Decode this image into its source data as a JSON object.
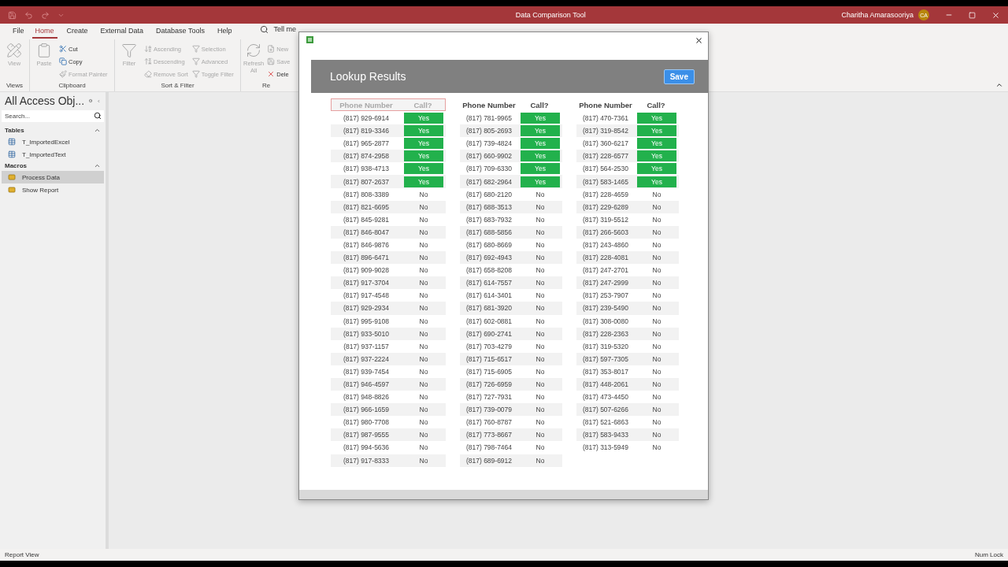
{
  "title_bar": {
    "title": "Data Comparison Tool",
    "user_name": "Charitha Amarasooriya",
    "user_initials": "CA"
  },
  "menu_tabs": [
    {
      "label": "File",
      "selected": false
    },
    {
      "label": "Home",
      "selected": true
    },
    {
      "label": "Create",
      "selected": false
    },
    {
      "label": "External Data",
      "selected": false
    },
    {
      "label": "Database Tools",
      "selected": false
    },
    {
      "label": "Help",
      "selected": false
    }
  ],
  "tell_me": "Tell me",
  "ribbon": [
    {
      "label": "Views",
      "items": [
        {
          "kind": "large",
          "label": "View",
          "disabled": true
        }
      ]
    },
    {
      "label": "Clipboard",
      "items": [
        {
          "kind": "large",
          "label": "Paste",
          "disabled": true
        },
        {
          "kind": "small",
          "label": "Cut",
          "disabled": false
        },
        {
          "kind": "small",
          "label": "Copy",
          "disabled": false
        },
        {
          "kind": "small",
          "label": "Format Painter",
          "disabled": true
        }
      ]
    },
    {
      "label": "Sort & Filter",
      "items": [
        {
          "kind": "large",
          "label": "Filter",
          "disabled": true
        },
        {
          "kind": "small",
          "label": "Ascending",
          "disabled": true
        },
        {
          "kind": "small",
          "label": "Descending",
          "disabled": true
        },
        {
          "kind": "small",
          "label": "Remove Sort",
          "disabled": true
        },
        {
          "kind": "small",
          "label": "Selection",
          "disabled": true
        },
        {
          "kind": "small",
          "label": "Advanced",
          "disabled": true
        },
        {
          "kind": "small",
          "label": "Toggle Filter",
          "disabled": true
        }
      ]
    },
    {
      "label": "Re",
      "items": [
        {
          "kind": "large",
          "label": "Refresh All",
          "disabled": true
        },
        {
          "kind": "small",
          "label": "New",
          "disabled": true
        },
        {
          "kind": "small",
          "label": "Save",
          "disabled": true
        },
        {
          "kind": "small",
          "label": "Dele",
          "disabled": false
        }
      ]
    }
  ],
  "nav_pane": {
    "title": "All Access Obj...",
    "search_placeholder": "Search...",
    "sections": [
      {
        "title": "Tables",
        "expanded": true,
        "items": [
          {
            "label": "T_ImportedExcel",
            "selected": false
          },
          {
            "label": "T_ImportedText",
            "selected": false
          }
        ]
      },
      {
        "title": "Macros",
        "expanded": true,
        "items": [
          {
            "label": "Process Data",
            "selected": true
          },
          {
            "label": "Show Report",
            "selected": false
          }
        ]
      }
    ]
  },
  "dialog": {
    "heading": "Lookup Results",
    "save_button": "Save",
    "tables": [
      {
        "focused": true,
        "columns": [
          "Phone Number",
          "Call?"
        ],
        "rows": [
          {
            "phone": "(817) 929-6914",
            "call": "Yes",
            "highlighted": true
          },
          {
            "phone": "(817) 819-3346",
            "call": "Yes",
            "highlighted": true
          },
          {
            "phone": "(817) 965-2877",
            "call": "Yes",
            "highlighted": true
          },
          {
            "phone": "(817) 874-2958",
            "call": "Yes",
            "highlighted": true
          },
          {
            "phone": "(817) 938-4713",
            "call": "Yes",
            "highlighted": true
          },
          {
            "phone": "(817) 807-2637",
            "call": "Yes",
            "highlighted": true
          },
          {
            "phone": "(817) 808-3389",
            "call": "No",
            "highlighted": false
          },
          {
            "phone": "(817) 821-6695",
            "call": "No",
            "highlighted": false
          },
          {
            "phone": "(817) 845-9281",
            "call": "No",
            "highlighted": false
          },
          {
            "phone": "(817) 846-8047",
            "call": "No",
            "highlighted": false
          },
          {
            "phone": "(817) 846-9876",
            "call": "No",
            "highlighted": false
          },
          {
            "phone": "(817) 896-6471",
            "call": "No",
            "highlighted": false
          },
          {
            "phone": "(817) 909-9028",
            "call": "No",
            "highlighted": false
          },
          {
            "phone": "(817) 917-3704",
            "call": "No",
            "highlighted": false
          },
          {
            "phone": "(817) 917-4548",
            "call": "No",
            "highlighted": false
          },
          {
            "phone": "(817) 929-2934",
            "call": "No",
            "highlighted": false
          },
          {
            "phone": "(817) 995-9108",
            "call": "No",
            "highlighted": false
          },
          {
            "phone": "(817) 933-5010",
            "call": "No",
            "highlighted": false
          },
          {
            "phone": "(817) 937-1157",
            "call": "No",
            "highlighted": false
          },
          {
            "phone": "(817) 937-2224",
            "call": "No",
            "highlighted": false
          },
          {
            "phone": "(817) 939-7454",
            "call": "No",
            "highlighted": false
          },
          {
            "phone": "(817) 946-4597",
            "call": "No",
            "highlighted": false
          },
          {
            "phone": "(817) 948-8826",
            "call": "No",
            "highlighted": false
          },
          {
            "phone": "(817) 966-1659",
            "call": "No",
            "highlighted": false
          },
          {
            "phone": "(817) 980-7708",
            "call": "No",
            "highlighted": false
          },
          {
            "phone": "(817) 987-9555",
            "call": "No",
            "highlighted": false
          },
          {
            "phone": "(817) 994-5636",
            "call": "No",
            "highlighted": false
          },
          {
            "phone": "(817) 917-8333",
            "call": "No",
            "highlighted": false
          }
        ]
      },
      {
        "focused": false,
        "columns": [
          "Phone Number",
          "Call?"
        ],
        "rows": [
          {
            "phone": "(817) 781-9965",
            "call": "Yes",
            "highlighted": true
          },
          {
            "phone": "(817) 805-2693",
            "call": "Yes",
            "highlighted": true
          },
          {
            "phone": "(817) 739-4824",
            "call": "Yes",
            "highlighted": true
          },
          {
            "phone": "(817) 660-9902",
            "call": "Yes",
            "highlighted": true
          },
          {
            "phone": "(817) 709-6330",
            "call": "Yes",
            "highlighted": true
          },
          {
            "phone": "(817) 682-2964",
            "call": "Yes",
            "highlighted": true
          },
          {
            "phone": "(817) 680-2120",
            "call": "No",
            "highlighted": false
          },
          {
            "phone": "(817) 688-3513",
            "call": "No",
            "highlighted": false
          },
          {
            "phone": "(817) 683-7932",
            "call": "No",
            "highlighted": false
          },
          {
            "phone": "(817) 688-5856",
            "call": "No",
            "highlighted": false
          },
          {
            "phone": "(817) 680-8669",
            "call": "No",
            "highlighted": false
          },
          {
            "phone": "(817) 692-4943",
            "call": "No",
            "highlighted": false
          },
          {
            "phone": "(817) 658-8208",
            "call": "No",
            "highlighted": false
          },
          {
            "phone": "(817) 614-7557",
            "call": "No",
            "highlighted": false
          },
          {
            "phone": "(817) 614-3401",
            "call": "No",
            "highlighted": false
          },
          {
            "phone": "(817) 681-3920",
            "call": "No",
            "highlighted": false
          },
          {
            "phone": "(817) 602-0881",
            "call": "No",
            "highlighted": false
          },
          {
            "phone": "(817) 690-2741",
            "call": "No",
            "highlighted": false
          },
          {
            "phone": "(817) 703-4279",
            "call": "No",
            "highlighted": false
          },
          {
            "phone": "(817) 715-6517",
            "call": "No",
            "highlighted": false
          },
          {
            "phone": "(817) 715-6905",
            "call": "No",
            "highlighted": false
          },
          {
            "phone": "(817) 726-6959",
            "call": "No",
            "highlighted": false
          },
          {
            "phone": "(817) 727-7931",
            "call": "No",
            "highlighted": false
          },
          {
            "phone": "(817) 739-0079",
            "call": "No",
            "highlighted": false
          },
          {
            "phone": "(817) 760-8787",
            "call": "No",
            "highlighted": false
          },
          {
            "phone": "(817) 773-8667",
            "call": "No",
            "highlighted": false
          },
          {
            "phone": "(817) 798-7464",
            "call": "No",
            "highlighted": false
          },
          {
            "phone": "(817) 689-6912",
            "call": "No",
            "highlighted": false
          }
        ]
      },
      {
        "focused": false,
        "columns": [
          "Phone Number",
          "Call?"
        ],
        "rows": [
          {
            "phone": "(817) 470-7361",
            "call": "Yes",
            "highlighted": true
          },
          {
            "phone": "(817) 319-8542",
            "call": "Yes",
            "highlighted": true
          },
          {
            "phone": "(817) 360-6217",
            "call": "Yes",
            "highlighted": true
          },
          {
            "phone": "(817) 228-6577",
            "call": "Yes",
            "highlighted": true
          },
          {
            "phone": "(817) 564-2530",
            "call": "Yes",
            "highlighted": true
          },
          {
            "phone": "(817) 583-1465",
            "call": "Yes",
            "highlighted": true
          },
          {
            "phone": "(817) 228-4659",
            "call": "No",
            "highlighted": false
          },
          {
            "phone": "(817) 229-6289",
            "call": "No",
            "highlighted": false
          },
          {
            "phone": "(817) 319-5512",
            "call": "No",
            "highlighted": false
          },
          {
            "phone": "(817) 266-5603",
            "call": "No",
            "highlighted": false
          },
          {
            "phone": "(817) 243-4860",
            "call": "No",
            "highlighted": false
          },
          {
            "phone": "(817) 228-4081",
            "call": "No",
            "highlighted": false
          },
          {
            "phone": "(817) 247-2701",
            "call": "No",
            "highlighted": false
          },
          {
            "phone": "(817) 247-2999",
            "call": "No",
            "highlighted": false
          },
          {
            "phone": "(817) 253-7907",
            "call": "No",
            "highlighted": false
          },
          {
            "phone": "(817) 239-5490",
            "call": "No",
            "highlighted": false
          },
          {
            "phone": "(817) 308-0080",
            "call": "No",
            "highlighted": false
          },
          {
            "phone": "(817) 228-2363",
            "call": "No",
            "highlighted": false
          },
          {
            "phone": "(817) 319-5320",
            "call": "No",
            "highlighted": false
          },
          {
            "phone": "(817) 597-7305",
            "call": "No",
            "highlighted": false
          },
          {
            "phone": "(817) 353-8017",
            "call": "No",
            "highlighted": false
          },
          {
            "phone": "(817) 448-2061",
            "call": "No",
            "highlighted": false
          },
          {
            "phone": "(817) 473-4450",
            "call": "No",
            "highlighted": false
          },
          {
            "phone": "(817) 507-6266",
            "call": "No",
            "highlighted": false
          },
          {
            "phone": "(817) 521-6863",
            "call": "No",
            "highlighted": false
          },
          {
            "phone": "(817) 583-9433",
            "call": "No",
            "highlighted": false
          },
          {
            "phone": "(817) 313-5949",
            "call": "No",
            "highlighted": false
          }
        ]
      }
    ]
  },
  "status_bar": {
    "left": "Report View",
    "right": "Num Lock"
  }
}
